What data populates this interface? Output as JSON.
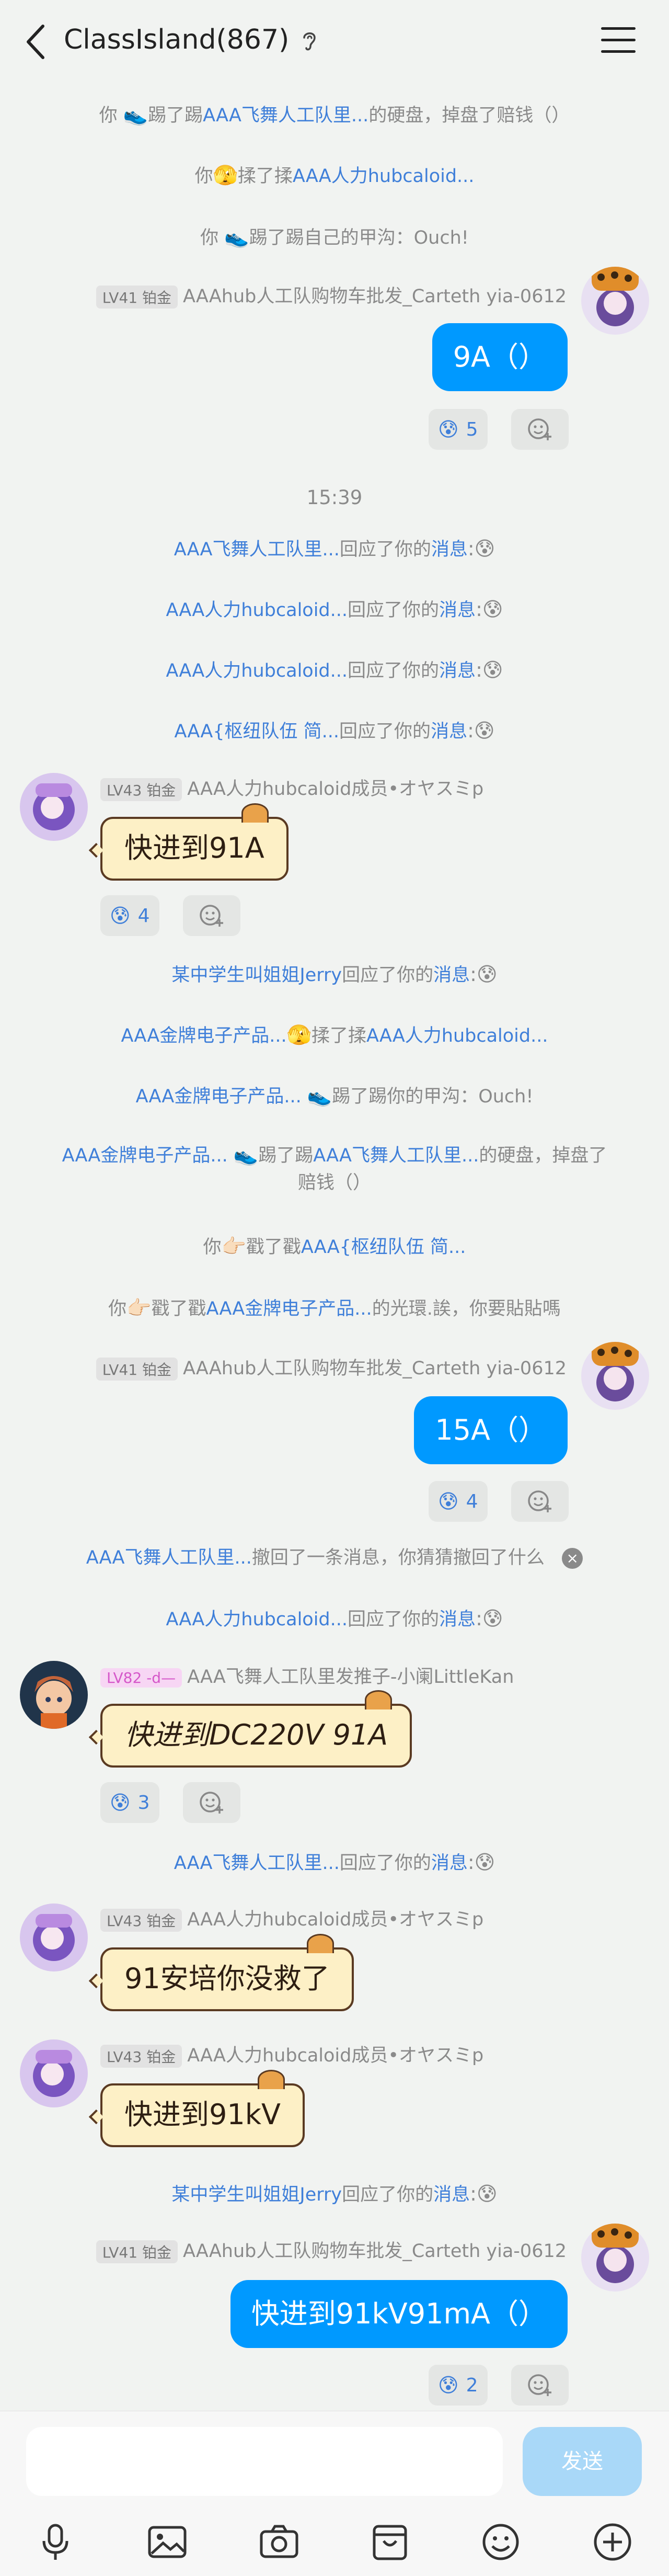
{
  "header": {
    "title": "ClassIsland(867)"
  },
  "messages": {
    "s1": {
      "a": "你 ",
      "emoji": "👟",
      "b": "踢了踢",
      "link": "AAA飞舞人工队里...",
      "c": "的硬盘，掉盘了赔钱（）"
    },
    "s2": {
      "a": "你",
      "emoji": "🫣",
      "b": "揉了揉",
      "link": "AAA人力hubcaloid..."
    },
    "s3": {
      "a": "你 ",
      "emoji": "👟",
      "b": "踢了踢自己的甲沟：Ouch!"
    },
    "m1": {
      "level": "LV41 铂金",
      "sender": "AAAhub人工队购物车批发_Carteth yia-0612",
      "text": "9A（）",
      "react_emoji": "😰",
      "react_count": "5"
    },
    "time": "15:39",
    "s4": {
      "link": "AAA飞舞人工队里...",
      "b": "回应了你的",
      "link2": "消息",
      "emoji": ":😰"
    },
    "s5": {
      "link": "AAA人力hubcaloid...",
      "b": "回应了你的",
      "link2": "消息",
      "emoji": ":😰"
    },
    "s6": {
      "link": "AAA人力hubcaloid...",
      "b": "回应了你的",
      "link2": "消息",
      "emoji": ":😰"
    },
    "s7": {
      "link": "AAA{枢纽队伍 简...",
      "b": "回应了你的",
      "link2": "消息",
      "emoji": ":😰"
    },
    "m2": {
      "level": "LV43 铂金",
      "sender": "AAA人力hubcaloid成员•オヤスミp",
      "text": "快进到91A",
      "react_emoji": "😰",
      "react_count": "4"
    },
    "s8": {
      "link": "某中学生叫姐姐Jerry",
      "b": "回应了你的",
      "link2": "消息",
      "emoji": ":😰"
    },
    "s9": {
      "link": "AAA金牌电子产品...",
      "emoji": "🫣",
      "b": "揉了揉",
      "link2": "AAA人力hubcaloid..."
    },
    "s10": {
      "link": "AAA金牌电子产品... ",
      "emoji": "👟",
      "b": "踢了踢你的甲沟：Ouch!"
    },
    "s11": {
      "link": "AAA金牌电子产品... ",
      "emoji": "👟",
      "b": "踢了踢",
      "link2": "AAA飞舞人工队里...",
      "c": "的硬盘，掉盘了",
      "d": "赔钱（）"
    },
    "s12": {
      "a": "你",
      "emoji": "👉🏻",
      "b": "戳了戳",
      "link": "AAA{枢纽队伍 简..."
    },
    "s13": {
      "a": "你",
      "emoji": "👉🏻",
      "b": "戳了戳",
      "link": "AAA金牌电子产品...",
      "c": "的光環.誒，你要貼貼嗎"
    },
    "m3": {
      "level": "LV41 铂金",
      "sender": "AAAhub人工队购物车批发_Carteth yia-0612",
      "text": "15A（）",
      "react_emoji": "😰",
      "react_count": "4"
    },
    "s14": {
      "link": "AAA飞舞人工队里...",
      "b": "撤回了一条消息，你猜猜撤回了什么",
      "close": "×"
    },
    "s15": {
      "link": "AAA人力hubcaloid...",
      "b": "回应了你的",
      "link2": "消息",
      "emoji": ":😰"
    },
    "m4": {
      "level": "LV82 -d—",
      "sender": "AAA飞舞人工队里发推子-小阑LittleKan",
      "text": "快进到DC220V 91A",
      "react_emoji": "😰",
      "react_count": "3"
    },
    "s16": {
      "link": "AAA飞舞人工队里...",
      "b": "回应了你的",
      "link2": "消息",
      "emoji": ":😰"
    },
    "m5": {
      "level": "LV43 铂金",
      "sender": "AAA人力hubcaloid成员•オヤスミp",
      "text": "91安培你没救了"
    },
    "m6": {
      "level": "LV43 铂金",
      "sender": "AAA人力hubcaloid成员•オヤスミp",
      "text": "快进到91kV"
    },
    "s17": {
      "link": "某中学生叫姐姐Jerry",
      "b": "回应了你的",
      "link2": "消息",
      "emoji": ":😰"
    },
    "m7": {
      "level": "LV41 铂金",
      "sender": "AAAhub人工队购物车批发_Carteth yia-0612",
      "text": "快进到91kV91mA（）",
      "react_emoji": "😰",
      "react_count": "2"
    }
  },
  "composer": {
    "send_label": "发送"
  },
  "colors": {
    "accent": "#0099ff",
    "link": "#3f7fd9",
    "background": "#f1f3f1"
  }
}
